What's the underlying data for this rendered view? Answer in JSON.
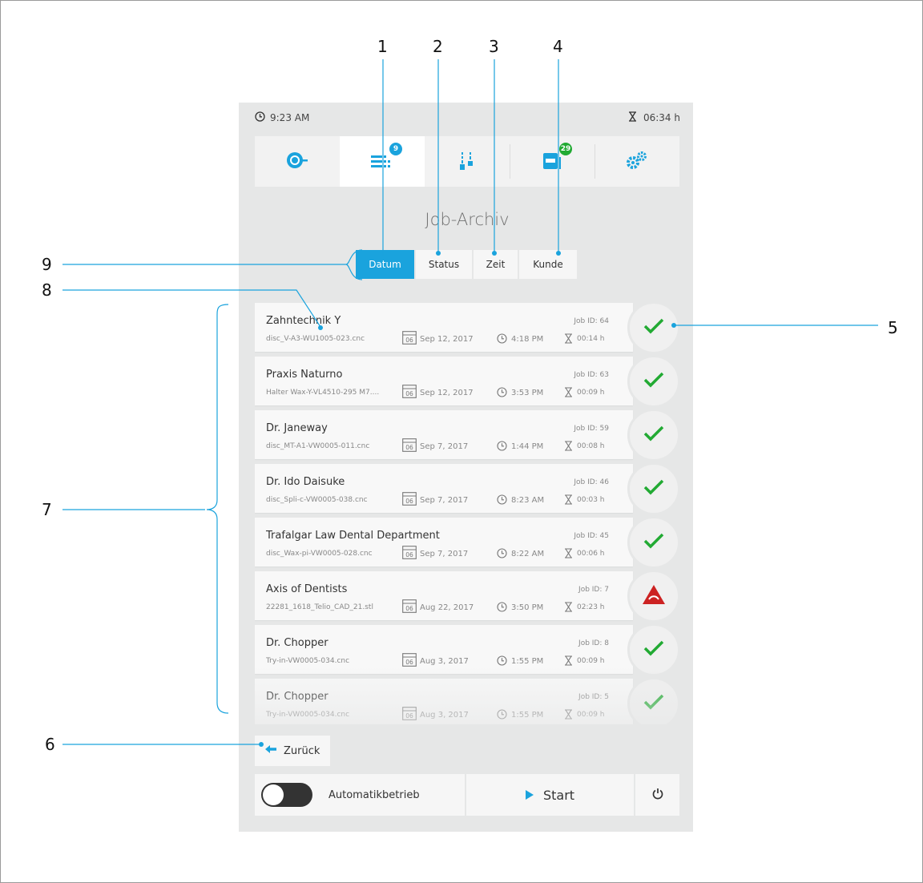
{
  "status_bar": {
    "time": "9:23 AM",
    "remaining": "06:34 h"
  },
  "nav": {
    "tabs": [
      {
        "name": "machine",
        "icon": "spindle-icon",
        "badge": ""
      },
      {
        "name": "job-list",
        "icon": "job-list-icon",
        "badge": "9",
        "badge_color": "#1aa3dd",
        "active": true
      },
      {
        "name": "tools",
        "icon": "tools-icon",
        "badge": ""
      },
      {
        "name": "materials",
        "icon": "material-icon",
        "badge": "29",
        "badge_color": "#22aa33"
      },
      {
        "name": "settings",
        "icon": "gears-icon",
        "badge": ""
      }
    ]
  },
  "page_title": "Job-Archiv",
  "sort": {
    "options": [
      {
        "label": "Datum",
        "active": true
      },
      {
        "label": "Status"
      },
      {
        "label": "Zeit"
      },
      {
        "label": "Kunde"
      }
    ]
  },
  "jobs": [
    {
      "customer": "Zahntechnik Y",
      "file": "disc_V-A3-WU1005-023.cnc",
      "date": "Sep 12, 2017",
      "time": "4:18 PM",
      "job_id": "Job ID: 64",
      "duration": "00:14 h",
      "status": "success"
    },
    {
      "customer": "Praxis Naturno",
      "file": "Halter Wax-Y-VL4510-295 M7....",
      "date": "Sep 12, 2017",
      "time": "3:53 PM",
      "job_id": "Job ID: 63",
      "duration": "00:09 h",
      "status": "success"
    },
    {
      "customer": "Dr. Janeway",
      "file": "disc_MT-A1-VW0005-011.cnc",
      "date": "Sep 7, 2017",
      "time": "1:44 PM",
      "job_id": "Job ID: 59",
      "duration": "00:08 h",
      "status": "success"
    },
    {
      "customer": "Dr. Ido Daisuke",
      "file": "disc_Spli-c-VW0005-038.cnc",
      "date": "Sep 7, 2017",
      "time": "8:23 AM",
      "job_id": "Job ID: 46",
      "duration": "00:03 h",
      "status": "success"
    },
    {
      "customer": "Trafalgar Law Dental Department",
      "file": "disc_Wax-pi-VW0005-028.cnc",
      "date": "Sep 7, 2017",
      "time": "8:22 AM",
      "job_id": "Job ID: 45",
      "duration": "00:06 h",
      "status": "success"
    },
    {
      "customer": "Axis of Dentists",
      "file": "22281_1618_Telio_CAD_21.stl",
      "date": "Aug 22, 2017",
      "time": "3:50 PM",
      "job_id": "Job ID: 7",
      "duration": "02:23 h",
      "status": "error"
    },
    {
      "customer": "Dr. Chopper",
      "file": "Try-in-VW0005-034.cnc",
      "date": "Aug 3, 2017",
      "time": "1:55 PM",
      "job_id": "Job ID: 8",
      "duration": "00:09 h",
      "status": "success"
    },
    {
      "customer": "Dr. Chopper",
      "file": "Try-in-VW0005-034.cnc",
      "date": "Aug 3, 2017",
      "time": "1:55 PM",
      "job_id": "Job ID: 5",
      "duration": "00:09 h",
      "status": "success"
    }
  ],
  "calendar_icon_text": "06",
  "back_button": "Zurück",
  "bottom": {
    "auto_mode_label": "Automatikbetrieb",
    "auto_mode_on": false,
    "start_label": "Start"
  },
  "callouts": [
    "1",
    "2",
    "3",
    "4",
    "5",
    "6",
    "7",
    "8",
    "9"
  ],
  "colors": {
    "accent": "#1aa3dd",
    "success": "#22aa33",
    "error": "#cc2222",
    "panel": "#e6e7e7"
  }
}
